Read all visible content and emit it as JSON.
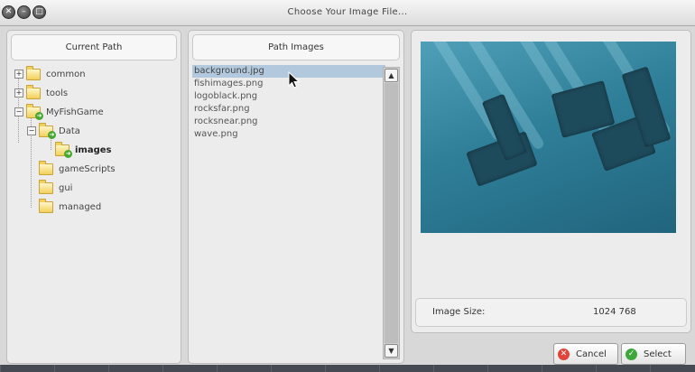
{
  "window": {
    "title": "Choose Your Image File..."
  },
  "titlebar_buttons": [
    {
      "name": "close-window-button",
      "glyph": "✕"
    },
    {
      "name": "minimize-window-button",
      "glyph": "–"
    },
    {
      "name": "maximize-window-button",
      "glyph": "□"
    }
  ],
  "current_path": {
    "header": "Current Path",
    "tree": [
      {
        "label": "common",
        "expander": "+"
      },
      {
        "label": "tools",
        "expander": "+"
      },
      {
        "label": "MyFishGame",
        "expander": "−"
      },
      {
        "label": "Data",
        "expander": "−"
      },
      {
        "label": "images",
        "expander": ""
      },
      {
        "label": "gameScripts",
        "expander": ""
      },
      {
        "label": "gui",
        "expander": ""
      },
      {
        "label": "managed",
        "expander": ""
      }
    ]
  },
  "path_images": {
    "header": "Path Images",
    "files": [
      "background.jpg",
      "fishimages.png",
      "logoblack.png",
      "rocksfar.png",
      "rocksnear.png",
      "wave.png"
    ],
    "selected_index": 0,
    "scroll_up": "▲",
    "scroll_down": "▼"
  },
  "preview": {
    "image_size_label": "Image Size:",
    "image_size_value": "1024 768"
  },
  "buttons": {
    "cancel_label": "Cancel",
    "cancel_icon": "✕",
    "select_label": "Select",
    "select_icon": "✓"
  },
  "colors": {
    "selection": "#b2c8dc",
    "cancel_icon": "#e0443a",
    "select_icon": "#3fa83a",
    "preview_water": "#2f7f99"
  }
}
